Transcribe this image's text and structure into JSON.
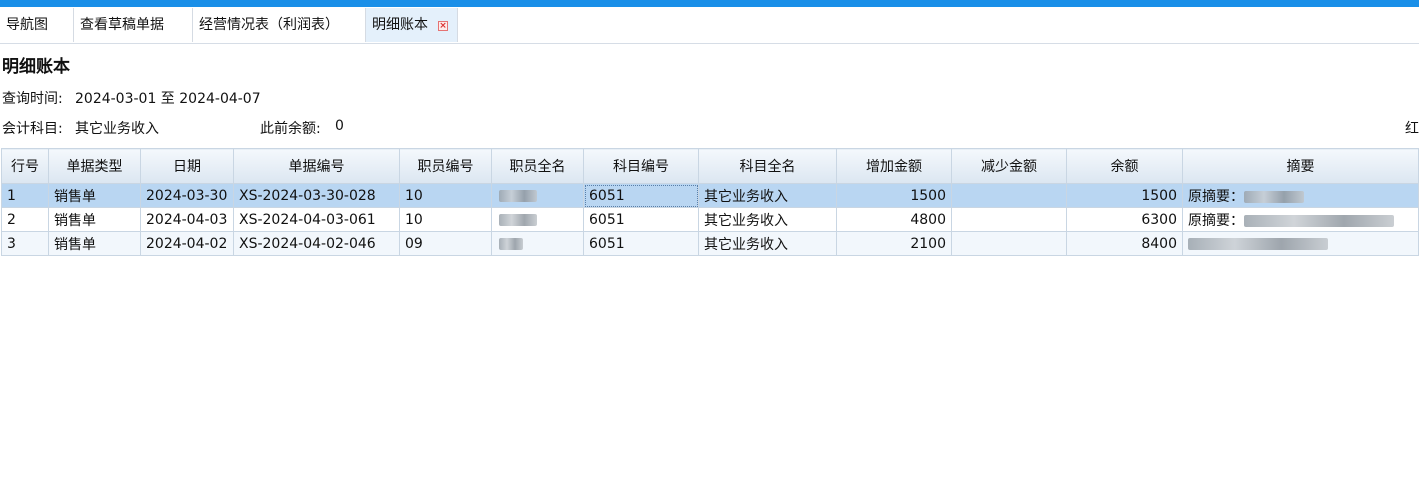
{
  "tabs": [
    {
      "label": "导航图"
    },
    {
      "label": "查看草稿单据"
    },
    {
      "label": "经营情况表（利润表）"
    },
    {
      "label": "明细账本",
      "close_symbol": "×"
    }
  ],
  "page_title": "明细账本",
  "query": {
    "time_label": "查询时间:",
    "time_value": "2024-03-01 至 2024-04-07",
    "subject_label": "会计科目:",
    "subject_value": "其它业务收入",
    "prior_balance_label": "此前余额:",
    "prior_balance_value": "0",
    "right_edge_text": "红"
  },
  "table": {
    "columns": [
      "行号",
      "单据类型",
      "日期",
      "单据编号",
      "职员编号",
      "职员全名",
      "科目编号",
      "科目全名",
      "增加金额",
      "减少金额",
      "余额",
      "摘要"
    ],
    "rows": [
      {
        "no": "1",
        "type": "销售单",
        "date": "2024-03-30",
        "doc": "XS-2024-03-30-028",
        "emp_no": "10",
        "emp_name": "",
        "subj_no": "6051",
        "subj_name": "其它业务收入",
        "increase": "1500",
        "decrease": "",
        "balance": "1500",
        "summary": "原摘要："
      },
      {
        "no": "2",
        "type": "销售单",
        "date": "2024-04-03",
        "doc": "XS-2024-04-03-061",
        "emp_no": "10",
        "emp_name": "",
        "subj_no": "6051",
        "subj_name": "其它业务收入",
        "increase": "4800",
        "decrease": "",
        "balance": "6300",
        "summary": "原摘要："
      },
      {
        "no": "3",
        "type": "销售单",
        "date": "2024-04-02",
        "doc": "XS-2024-04-02-046",
        "emp_no": "09",
        "emp_name": "",
        "subj_no": "6051",
        "subj_name": "其它业务收入",
        "increase": "2100",
        "decrease": "",
        "balance": "8400",
        "summary": ""
      }
    ]
  },
  "colors": {
    "accent": "#1a8fe8",
    "selected_row": "#b9d6f2",
    "alt_row": "#f2f7fc",
    "header_bg": "#dbe6f1"
  }
}
